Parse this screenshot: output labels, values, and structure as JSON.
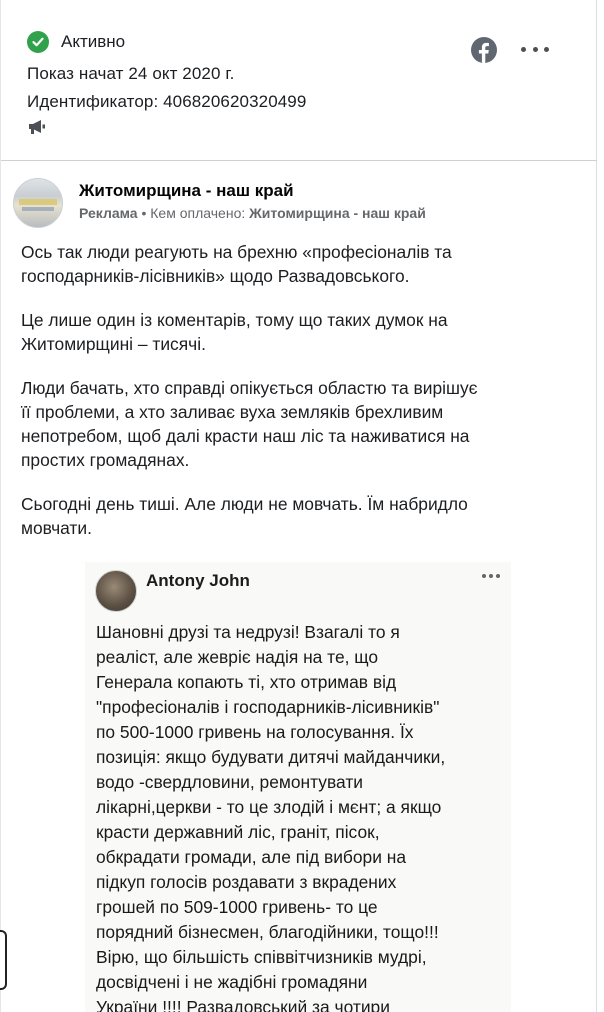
{
  "ad_info": {
    "status": "Активно",
    "started": "Показ начат 24 окт 2020 г.",
    "id_line": "Идентификатор: 406820620320499",
    "icons": [
      "check-icon",
      "megaphone-icon",
      "facebook-icon",
      "more-icon"
    ]
  },
  "post": {
    "page_name": "Житомирщина - наш край",
    "sponsored_label": "Реклама",
    "paid_by_label": "Кем оплачено:",
    "paid_by_name": "Житомирщина - наш край",
    "paragraphs": [
      "Ось так люди реагують на брехню «професіоналів та\nгосподарників-лісівників» щодо Развадовського.",
      "Це лише один із коментарів, тому що таких думок на\nЖитомирщині – тисячі.",
      "Люди бачать, хто справді опікується областю та вирішує\nїї проблеми, а хто заливає вуха земляків брехливим\nнепотребом, щоб далі красти наш ліс та наживатися на\nпростих громадянах.",
      "Сьогодні день тиші. Але люди не мовчать. Їм набридло\nмовчати."
    ]
  },
  "embedded_comment": {
    "author": "Antony John",
    "text": "Шановні друзі та недрузі! Взагалі то я\nреаліст, але жевріє надія на те, що\nГенерала копають ті, хто отримав від\n\"професіоналів і господарників-лісивників\"\nпо 500-1000 гривень на голосування. Їх\nпозиція: якщо будувати дитячі майданчики,\nводо -свердловини, ремонтувати\nлікарні,церкви - то це злодій і мєнт; а якщо\nкрасти державний ліс, граніт, пісок,\nобкрадати громади, але під вибори на\nпідкуп голосів роздавати з вкрадених\nгрошей по 509-1000 гривень- то це\nпорядний бізнесмен, благодійники, тощо!!!\nВірю, що більшість співвітчизників мудрі,\nдосвідчені і не жадібні громадяни\nУкраїни !!!! Развадовський за чотири"
  },
  "colors": {
    "status_green": "#31a24c",
    "text": "#1c1e21",
    "secondary": "#65676b"
  }
}
